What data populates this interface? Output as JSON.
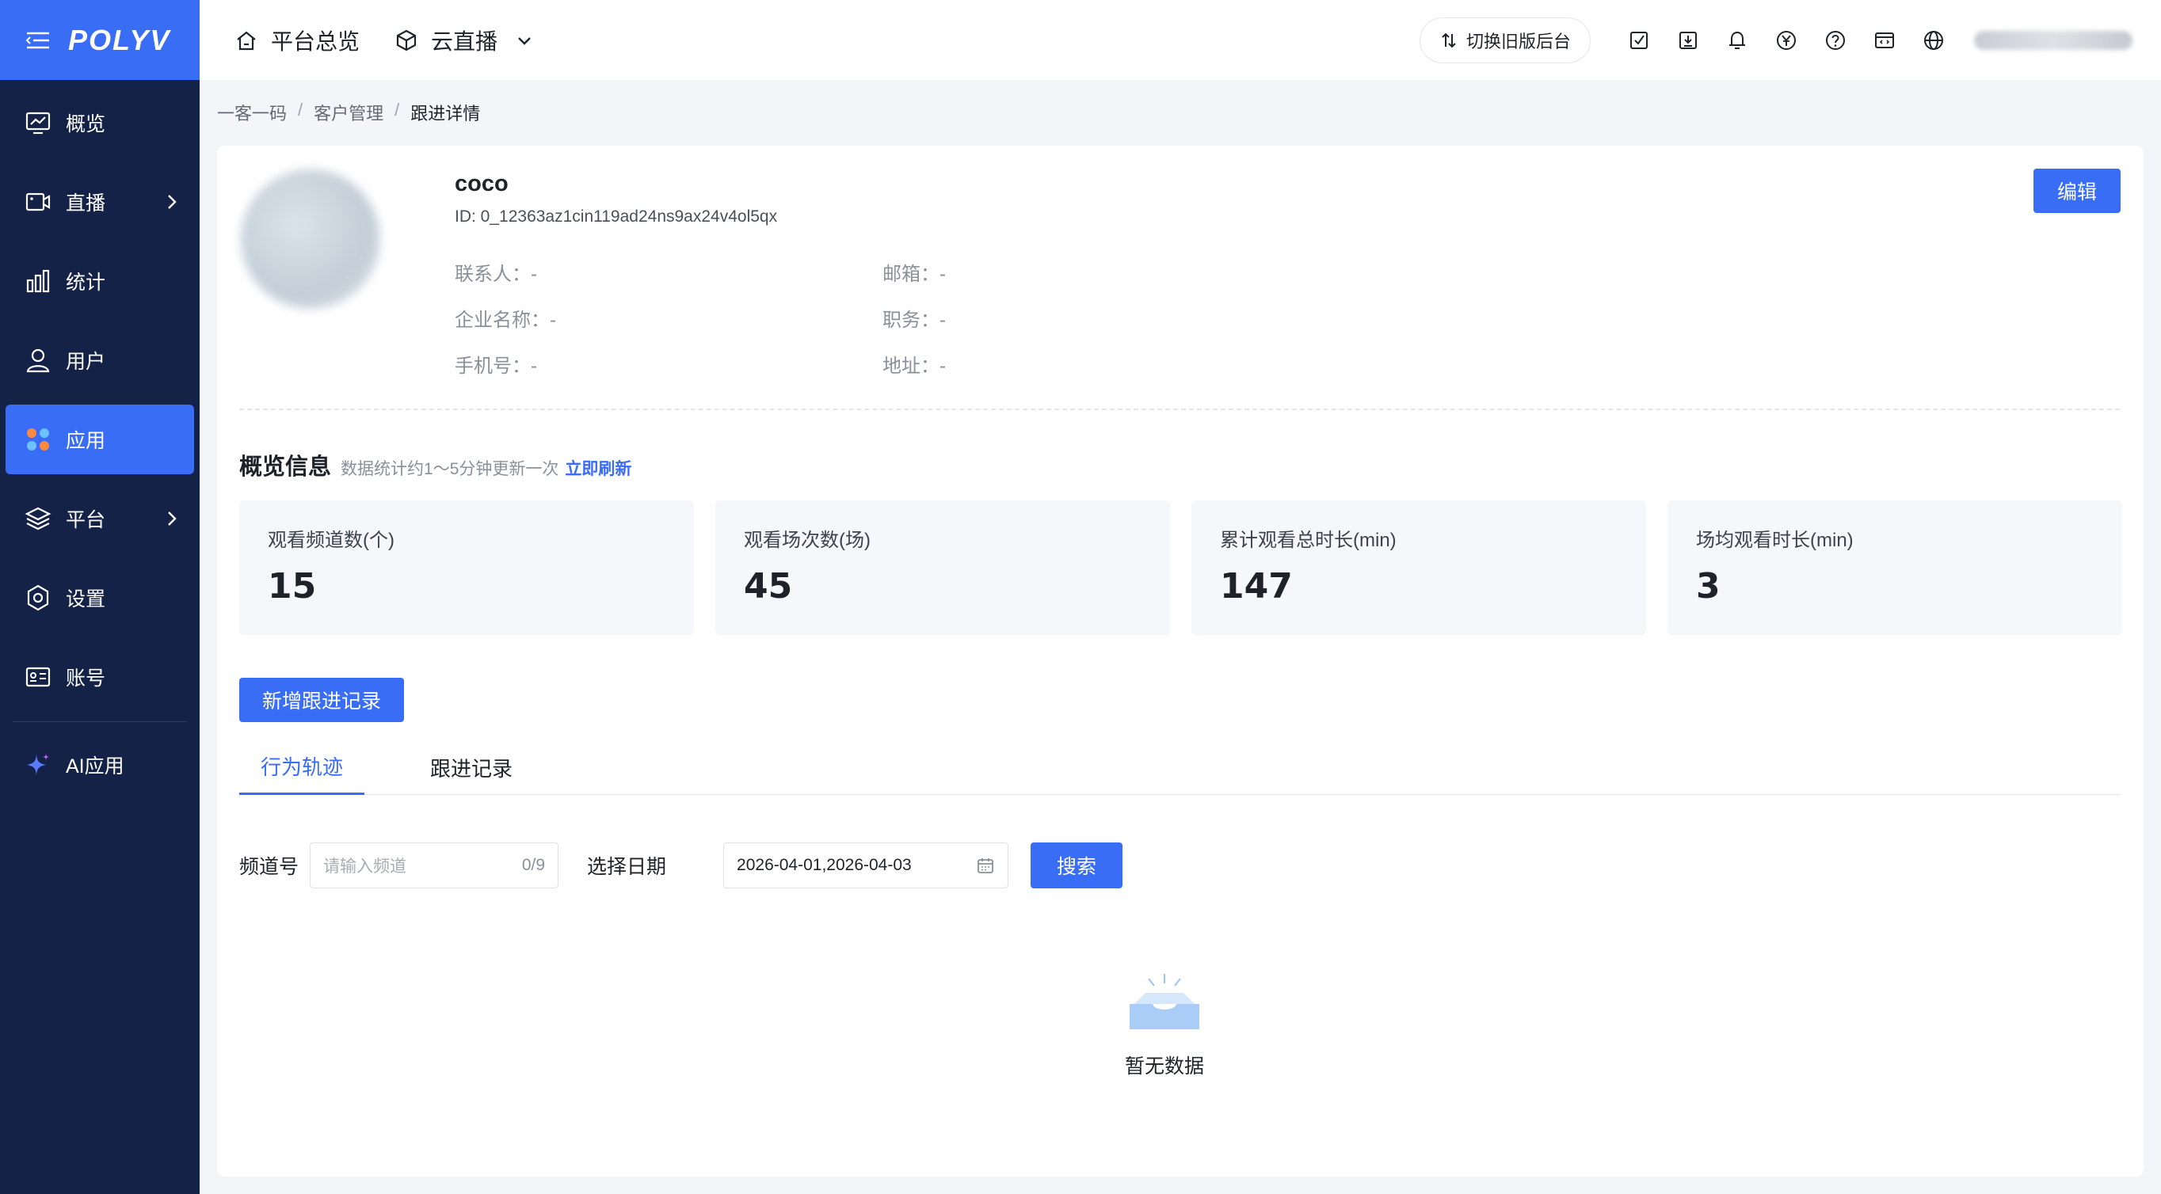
{
  "app": {
    "logo": "POLYV"
  },
  "sidebar": {
    "items": [
      {
        "label": "概览",
        "icon": "monitor-chart-icon"
      },
      {
        "label": "直播",
        "icon": "video-camera-icon"
      },
      {
        "label": "统计",
        "icon": "bar-chart-icon"
      },
      {
        "label": "用户",
        "icon": "user-icon"
      },
      {
        "label": "应用",
        "icon": "apps-grid-icon"
      },
      {
        "label": "平台",
        "icon": "layers-icon"
      },
      {
        "label": "设置",
        "icon": "gear-icon"
      },
      {
        "label": "账号",
        "icon": "id-card-icon"
      },
      {
        "label": "AI应用",
        "icon": "sparkle-icon"
      }
    ],
    "active": "应用"
  },
  "topbar": {
    "overview": "平台总览",
    "product": "云直播",
    "switch_label": "切换旧版后台"
  },
  "breadcrumb": [
    "一客一码",
    "客户管理",
    "跟进详情"
  ],
  "customer": {
    "name": "coco",
    "id": "ID: 0_12363az1cin119ad24ns9ax24v4ol5qx",
    "contact": "联系人：-",
    "email": "邮箱：-",
    "company": "企业名称：-",
    "position": "职务：-",
    "phone": "手机号：-",
    "address": "地址：-",
    "edit_label": "编辑"
  },
  "overview": {
    "title": "概览信息",
    "subtitle": "数据统计约1～5分钟更新一次",
    "refresh": "立即刷新",
    "stats": [
      {
        "label": "观看频道数(个)",
        "value": "15"
      },
      {
        "label": "观看场次数(场)",
        "value": "45"
      },
      {
        "label": "累计观看总时长(min)",
        "value": "147"
      },
      {
        "label": "场均观看时长(min)",
        "value": "3"
      }
    ]
  },
  "actions": {
    "add_record": "新增跟进记录"
  },
  "tabs": [
    {
      "label": "行为轨迹",
      "active": true
    },
    {
      "label": "跟进记录",
      "active": false
    }
  ],
  "filter": {
    "channel_label": "频道号",
    "channel_placeholder": "请输入频道",
    "channel_count": "0/9",
    "date_label": "选择日期",
    "date_value": "2026-04-01,2026-04-03",
    "search": "搜索"
  },
  "empty": {
    "text": "暂无数据"
  },
  "colors": {
    "primary": "#3a6df5",
    "sidebar": "#142247"
  }
}
